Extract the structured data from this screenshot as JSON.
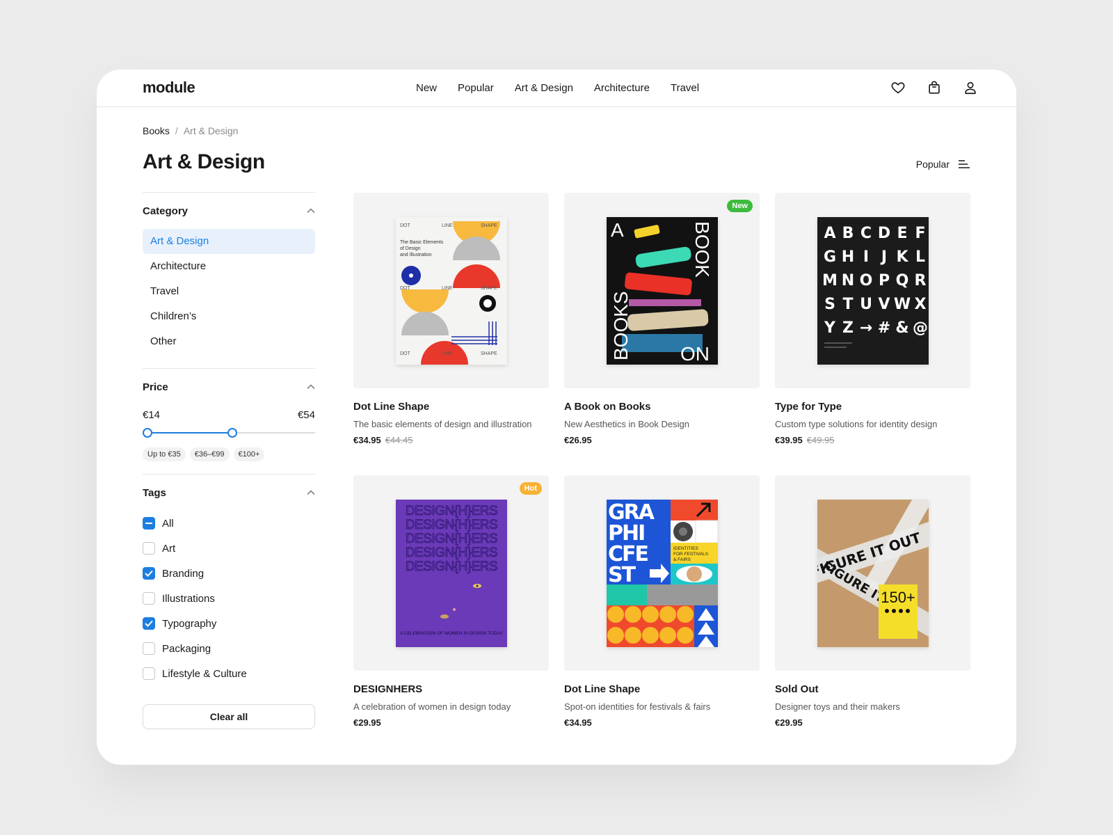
{
  "header": {
    "logo": "module",
    "nav": [
      "New",
      "Popular",
      "Art & Design",
      "Architecture",
      "Travel"
    ],
    "icons": [
      "heart-icon",
      "bag-icon",
      "user-icon"
    ]
  },
  "breadcrumb": {
    "root": "Books",
    "separator": "/",
    "current": "Art & Design"
  },
  "page_title": "Art & Design",
  "sort": {
    "label": "Popular",
    "icon": "sort-icon"
  },
  "sidebar": {
    "category": {
      "title": "Category",
      "items": [
        "Art & Design",
        "Architecture",
        "Travel",
        "Children’s",
        "Other"
      ],
      "active": "Art & Design"
    },
    "price": {
      "title": "Price",
      "min_label": "€14",
      "max_label": "€54",
      "range_fill_start": 0.03,
      "range_fill_end": 0.52,
      "chips": [
        "Up to €35",
        "€36–€99",
        "€100+"
      ]
    },
    "tags": {
      "title": "Tags",
      "items": [
        {
          "label": "All",
          "state": "partial"
        },
        {
          "label": "Art",
          "state": "unchecked"
        },
        {
          "label": "Branding",
          "state": "checked"
        },
        {
          "label": "Illustrations",
          "state": "unchecked"
        },
        {
          "label": "Typography",
          "state": "checked"
        },
        {
          "label": "Packaging",
          "state": "unchecked"
        },
        {
          "label": "Lifestyle & Culture",
          "state": "unchecked"
        }
      ]
    },
    "clear_all": "Clear all"
  },
  "products": [
    {
      "title": "Dot Line Shape",
      "subtitle": "The basic elements of design and illustration",
      "price": "€34.95",
      "old_price": "€44.45",
      "badge": "",
      "badge_color": "",
      "cover": "dls"
    },
    {
      "title": "A Book on Books",
      "subtitle": "New Aesthetics in Book Design",
      "price": "€26.95",
      "old_price": "",
      "badge": "New",
      "badge_color": "#3dbb3d",
      "cover": "books"
    },
    {
      "title": "Type for Type",
      "subtitle": "Custom type solutions for identity design",
      "price": "€39.95",
      "old_price": "€49.95",
      "badge": "",
      "badge_color": "",
      "cover": "type"
    },
    {
      "title": "DESIGNHERS",
      "subtitle": "A celebration of women in design today",
      "price": "€29.95",
      "old_price": "",
      "badge": "Hot",
      "badge_color": "#f7b134",
      "cover": "designhers"
    },
    {
      "title": "Dot Line Shape",
      "subtitle": "Spot-on identities for festivals & fairs",
      "price": "€34.95",
      "old_price": "",
      "badge": "",
      "badge_color": "",
      "cover": "graphic"
    },
    {
      "title": "Sold Out",
      "subtitle": "Designer toys and their makers",
      "price": "€29.95",
      "old_price": "",
      "badge": "",
      "badge_color": "",
      "cover": "figure"
    }
  ],
  "cover_text": {
    "dls": {
      "dot": "DOT",
      "line": "LINE",
      "shape": "SHAPE",
      "blurb1": "The Basic Elements",
      "blurb2": "of Design",
      "blurb3": "and Illustration"
    },
    "books": {
      "a": "A",
      "book": "BOOK",
      "books": "BOOKS",
      "on": "ON"
    },
    "type": {
      "glyphs": [
        "A",
        "B",
        "C",
        "D",
        "E",
        "F",
        "G",
        "H",
        "I",
        "J",
        "K",
        "L",
        "M",
        "N",
        "O",
        "P",
        "Q",
        "R",
        "S",
        "T",
        "U",
        "V",
        "W",
        "X",
        "Y",
        "Z",
        "→",
        "#",
        "&",
        "@"
      ]
    },
    "designhers": {
      "line": "DESIGN{H}ERS",
      "footer": "A CELEBRATION OF WOMEN IN DESIGN TODAY"
    },
    "graphic": {
      "l1": "GRA",
      "l2": "PHI",
      "l3": "CFE",
      "l4": "ST",
      "box1": "IDENTITIES",
      "box2": "FOR FESTIVALS",
      "box3": "& FAIRS"
    },
    "figure": {
      "main": "FIGURE IT OUT",
      "count": "150+"
    }
  },
  "colors": {
    "accent": "#1d7ee0",
    "active_bg": "#e8f1fb",
    "thumb_bg": "#f3f3f3"
  }
}
